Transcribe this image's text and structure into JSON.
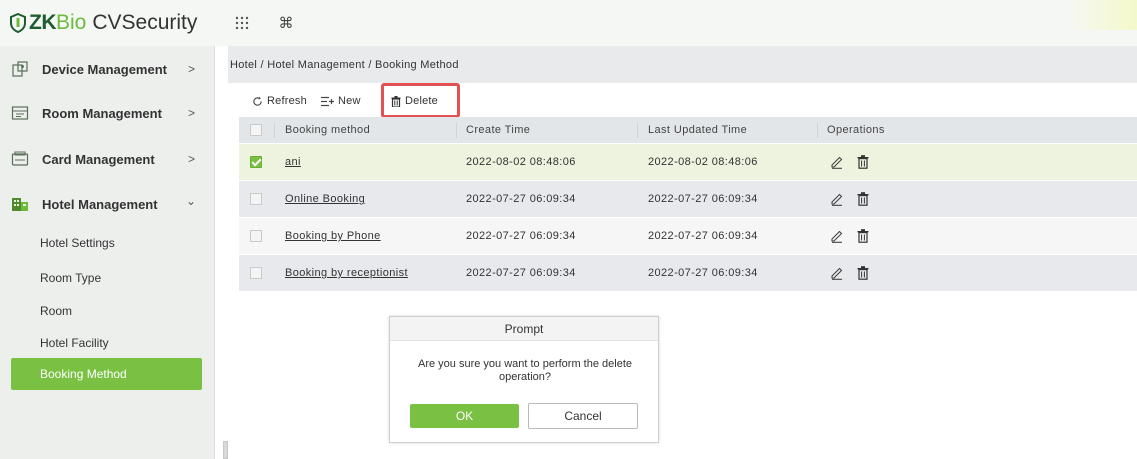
{
  "brand": {
    "zk": "ZK",
    "bio": "Bio",
    "cvs": "CVSecurity"
  },
  "topbar": {
    "apps_icon": "grid-dots-icon",
    "cmd_icon": "command-icon",
    "cmd_glyph": "⌘"
  },
  "sidebar": {
    "menus": [
      {
        "label": "Device Management",
        "icon": "device-icon",
        "arrow": ">"
      },
      {
        "label": "Room Management",
        "icon": "room-icon",
        "arrow": ">"
      },
      {
        "label": "Card Management",
        "icon": "card-icon",
        "arrow": ">"
      },
      {
        "label": "Hotel Management",
        "icon": "hotel-icon",
        "arrow": "⌄"
      }
    ],
    "subitems": [
      {
        "label": "Hotel Settings"
      },
      {
        "label": "Room Type"
      },
      {
        "label": "Room"
      },
      {
        "label": "Hotel Facility"
      },
      {
        "label": "Booking Method"
      }
    ],
    "active_color": "#7ac143"
  },
  "breadcrumb": "Hotel / Hotel Management / Booking Method",
  "toolbar": {
    "refresh": "Refresh",
    "new": "New",
    "delete": "Delete"
  },
  "table": {
    "headers": [
      "Booking method",
      "Create Time",
      "Last Updated Time",
      "Operations"
    ],
    "rows": [
      {
        "method": "ani",
        "created": "2022-08-02 08:48:06",
        "updated": "2022-08-02 08:48:06",
        "checked": true
      },
      {
        "method": "Online Booking",
        "created": "2022-07-27 06:09:34",
        "updated": "2022-07-27 06:09:34",
        "checked": false
      },
      {
        "method": "Booking by Phone",
        "created": "2022-07-27 06:09:34",
        "updated": "2022-07-27 06:09:34",
        "checked": false
      },
      {
        "method": "Booking by receptionist",
        "created": "2022-07-27 06:09:34",
        "updated": "2022-07-27 06:09:34",
        "checked": false
      }
    ]
  },
  "dialog": {
    "title": "Prompt",
    "message": "Are you sure you want to perform the delete operation?",
    "ok": "OK",
    "cancel": "Cancel"
  },
  "colors": {
    "accent": "#7ac143",
    "highlight": "#e25252",
    "brand_dark": "#1e5c2f"
  }
}
